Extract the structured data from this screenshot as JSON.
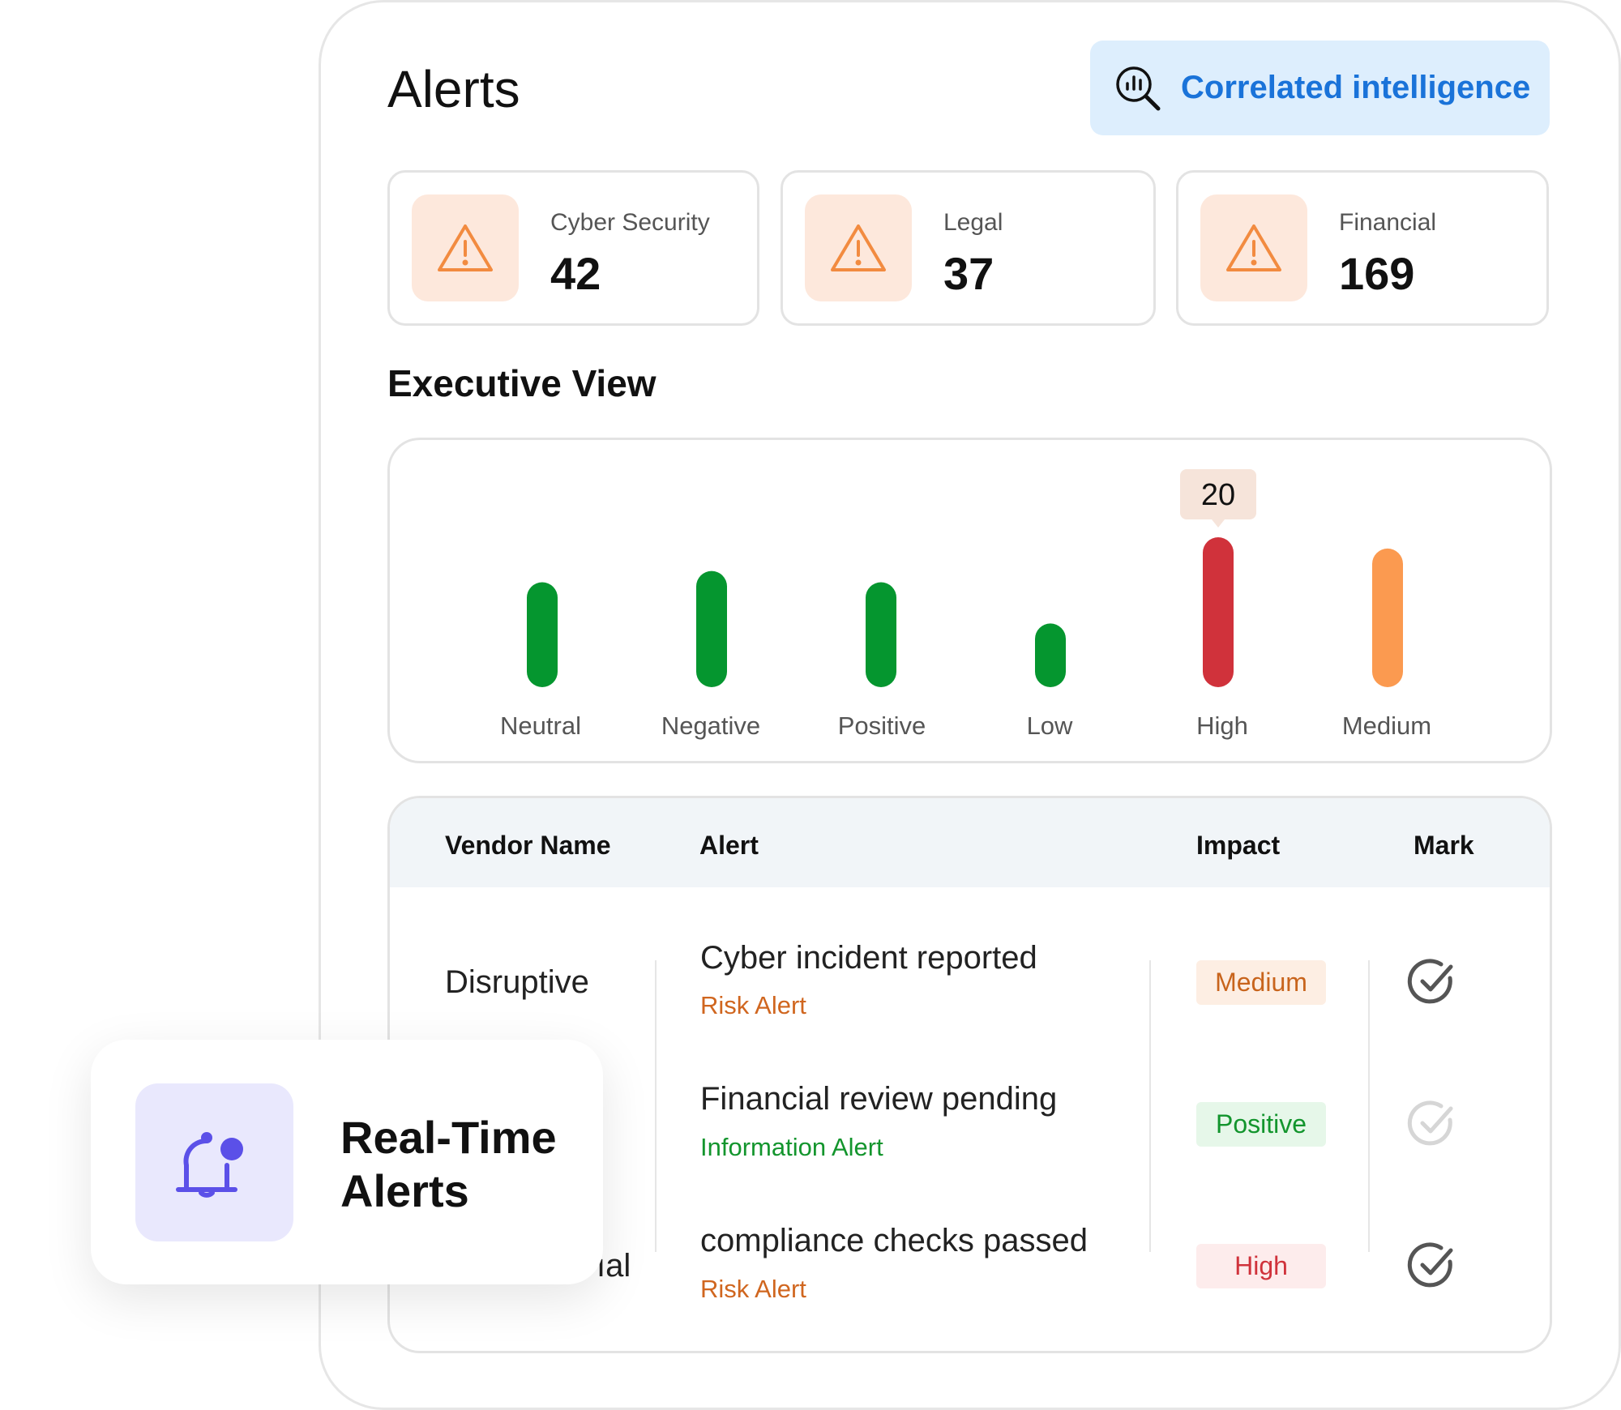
{
  "header": {
    "title": "Alerts",
    "action_label": "Correlated intelligence"
  },
  "stats": [
    {
      "label": "Cyber Security",
      "value": "42",
      "icon": "warning-icon"
    },
    {
      "label": "Legal",
      "value": "37",
      "icon": "warning-icon"
    },
    {
      "label": "Financial",
      "value": "169",
      "icon": "warning-icon"
    }
  ],
  "executive": {
    "title": "Executive View"
  },
  "chart_data": {
    "type": "bar",
    "categories": [
      "Neutral",
      "Negative",
      "Positive",
      "Low",
      "High",
      "Medium"
    ],
    "values": [
      14,
      15.5,
      14,
      8.5,
      20,
      18.5
    ],
    "colors": [
      "#05962f",
      "#05962f",
      "#05962f",
      "#05962f",
      "#d0323b",
      "#fb9a50"
    ],
    "highlight": {
      "category": "High",
      "label": "20"
    },
    "ylim": [
      0,
      20
    ],
    "grid": false
  },
  "table": {
    "columns": {
      "vendor": "Vendor Name",
      "alert": "Alert",
      "impact": "Impact",
      "mark": "Mark"
    },
    "rows": [
      {
        "vendor": "Disruptive",
        "alert": "Cyber incident reported",
        "type": "Risk Alert",
        "type_color": "#d0661f",
        "impact": "Medium",
        "impact_bg": "#fdeee3",
        "impact_color": "#c8641c",
        "marked": true
      },
      {
        "vendor": "",
        "alert": "Financial review pending",
        "type": "Information Alert",
        "type_color": "#13952d",
        "impact": "Positive",
        "impact_bg": "#e6f7e9",
        "impact_color": "#13952d",
        "marked": false
      },
      {
        "vendor": "ıal",
        "alert": "compliance checks passed",
        "type": "Risk Alert",
        "type_color": "#d0661f",
        "impact": "High",
        "impact_bg": "#fdecec",
        "impact_color": "#d0323b",
        "marked": true
      }
    ]
  },
  "floating_card": {
    "title": "Real-Time Alerts",
    "icon": "bell-notification-icon"
  },
  "colors": {
    "accent": "#1a73d9",
    "warning": "#f28b40",
    "bell": "#5b50e8"
  }
}
